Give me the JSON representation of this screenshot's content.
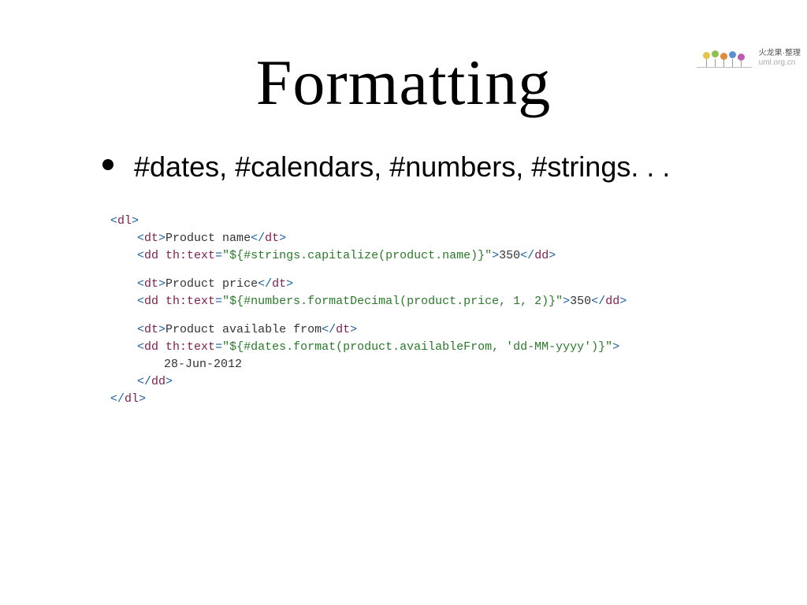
{
  "watermark": {
    "line1": "火龙果·整理",
    "line2": "uml.org.cn"
  },
  "title": "Formatting",
  "bullet": "#dates, #calendars, #numbers, #strings. . .",
  "code": {
    "dl_open": "dl",
    "dl_close": "dl",
    "dt": "dt",
    "dd": "dd",
    "th_text_attr": "th:text",
    "dt1_text": "Product name",
    "dd1_expr": "\"${#strings.capitalize(product.name)}\"",
    "dd1_inner": "350",
    "dt2_text": "Product price",
    "dd2_expr": "\"${#numbers.formatDecimal(product.price, 1, 2)}\"",
    "dd2_inner": "350",
    "dt3_text": "Product available from",
    "dd3_expr": "\"${#dates.format(product.availableFrom, 'dd-MM-yyyy')}\"",
    "dd3_inner": "28-Jun-2012"
  }
}
